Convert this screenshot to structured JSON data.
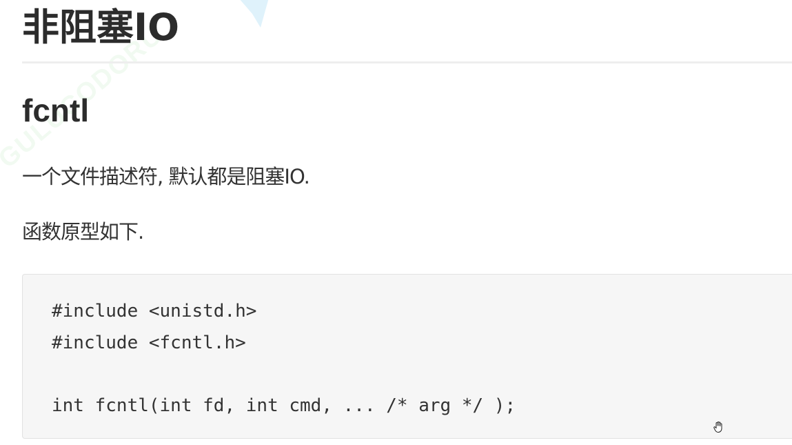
{
  "document": {
    "title": "非阻塞IO",
    "subtitle": "fcntl",
    "paragraphs": [
      "一个文件描述符, 默认都是阻塞IO.",
      "函数原型如下."
    ],
    "code_lines": [
      "#include <unistd.h>",
      "#include <fcntl.h>",
      "int fcntl(int fd, int cmd, ... /* arg */ );"
    ]
  },
  "watermark": {
    "text": "GULUCODORU"
  },
  "colors": {
    "heading": "#2c2c2c",
    "text": "#333333",
    "code_bg": "#f6f6f6",
    "code_border": "#e2e2e2",
    "rule": "#eeeeee",
    "logo_mark": "#dff2fb"
  },
  "icons": {
    "cursor": "hand-cursor-icon",
    "logo": "logo-mark-icon"
  }
}
